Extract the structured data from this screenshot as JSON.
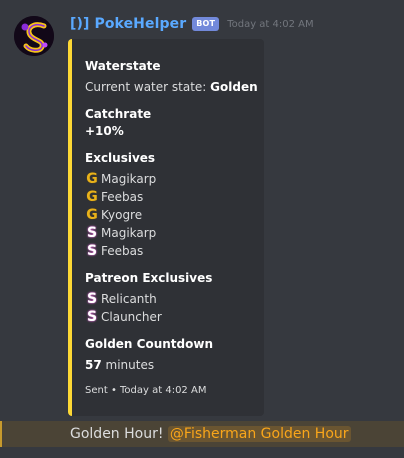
{
  "message": {
    "username": "[)] PokeHelper",
    "bot_tag": "BOT",
    "timestamp": "Today at 4:02 AM"
  },
  "embed": {
    "accent_color": "#fdd835",
    "fields": {
      "waterstate": {
        "name": "Waterstate",
        "value_prefix": "Current water state: ",
        "value_strong": "Golden"
      },
      "catchrate": {
        "name": "Catchrate",
        "value": "+10%"
      },
      "exclusives": {
        "name": "Exclusives",
        "items": [
          {
            "icon": "golden-g-icon",
            "label": "Magikarp"
          },
          {
            "icon": "golden-g-icon",
            "label": "Feebas"
          },
          {
            "icon": "golden-g-icon",
            "label": "Kyogre"
          },
          {
            "icon": "shiny-s-icon",
            "label": "Magikarp"
          },
          {
            "icon": "shiny-s-icon",
            "label": "Feebas"
          }
        ]
      },
      "patreon_exclusives": {
        "name": "Patreon Exclusives",
        "items": [
          {
            "icon": "shiny-s-icon",
            "label": "Relicanth"
          },
          {
            "icon": "shiny-s-icon",
            "label": "Clauncher"
          }
        ]
      },
      "golden_countdown": {
        "name": "Golden Countdown",
        "value_strong": "57",
        "value_suffix": " minutes"
      }
    },
    "footer": "Sent • Today at 4:02 AM"
  },
  "highlight": {
    "text": "Golden Hour! ",
    "mention": "@Fisherman Golden Hour"
  },
  "icons": {
    "golden_glyph": "G",
    "shiny_glyph": "S"
  }
}
